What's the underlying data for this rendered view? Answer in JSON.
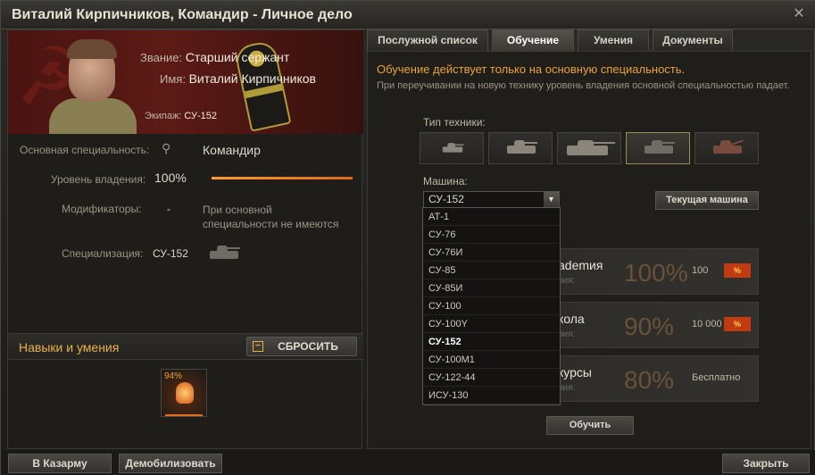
{
  "window": {
    "title": "Виталий Кирпичников, Командир - Личное дело",
    "close_icon": "close-icon"
  },
  "hero": {
    "rank_label": "Звание:",
    "rank_value": "Старший сержант",
    "name_label": "Имя:",
    "name_value": "Виталий Кирпичников",
    "crew_label": "Экипаж:",
    "crew_value": "СУ-152"
  },
  "details": {
    "spec_label": "Основная специальность:",
    "spec_value": "Командир",
    "mastery_label": "Уровень владения:",
    "mastery_value": "100%",
    "mastery_fraction": 1.0,
    "modifiers_label": "Модификаторы:",
    "modifiers_dash": "-",
    "modifiers_note": "При основной специальности не имеются",
    "specialization_label": "Специализация:",
    "specialization_value": "СУ-152"
  },
  "skills": {
    "title": "Навыки и умения",
    "reset_label": "СБРОСИТЬ",
    "slot_pct": "94%"
  },
  "tabs": [
    "Послужной список",
    "Обучение",
    "Умения",
    "Документы"
  ],
  "training": {
    "notice_main": "Обучение действует только на основную специальность.",
    "notice_sub": "При переучивании на новую технику уровень владения основной специальностью падает.",
    "vehicle_type_label": "Тип техники:",
    "vehicle_label": "Машина:",
    "selected_vehicle": "СУ-152",
    "current_vehicle_button": "Текущая машина",
    "train_button": "Обучить",
    "courses": [
      {
        "name": "ademия",
        "name_full": "академия",
        "sub": "ния:",
        "pct": "100%",
        "price": "100",
        "tag": "%"
      },
      {
        "name": "кола",
        "name_full": "школа",
        "sub": "ния:",
        "pct": "90%",
        "price": "10 000",
        "tag": "%"
      },
      {
        "name": "курсы",
        "name_full": "курсы",
        "sub": "ния:",
        "pct": "80%",
        "price": "Бесплатно",
        "tag": ""
      }
    ],
    "dropdown": [
      "АТ-1",
      "СУ-76",
      "СУ-76И",
      "СУ-85",
      "СУ-85И",
      "СУ-100",
      "СУ-100Y",
      "СУ-152",
      "СУ-100М1",
      "СУ-122-44",
      "ИСУ-130"
    ]
  },
  "footer": {
    "barracks": "В Казарму",
    "demobilize": "Демобилизовать",
    "close": "Закрыть"
  }
}
